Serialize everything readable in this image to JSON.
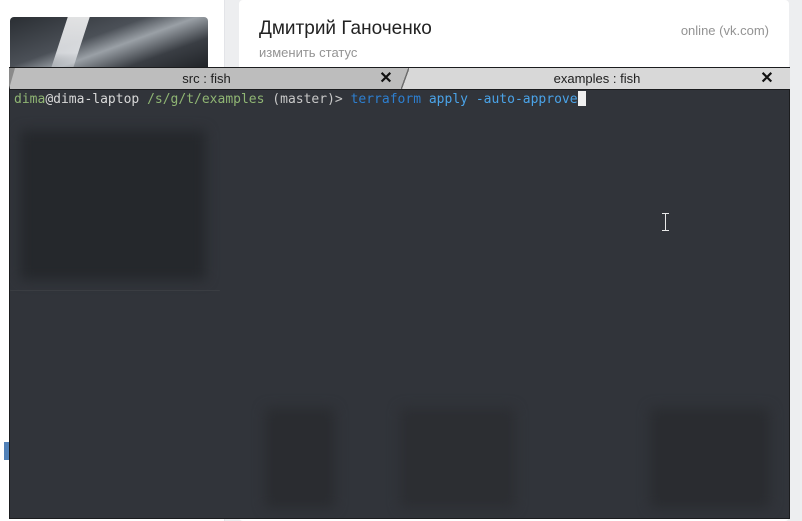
{
  "vk": {
    "profile_name": "Дмитрий Ганоченко",
    "status_link": "изменить статус",
    "online": "online",
    "online_source": "(vk.com)"
  },
  "terminal": {
    "tabs": [
      {
        "label": "src : fish",
        "close": "✕",
        "active": false
      },
      {
        "label": "examples : fish",
        "close": "✕",
        "active": true
      }
    ],
    "prompt": {
      "user": "dima",
      "at": "@",
      "host": "dima-laptop",
      "path": "/s/g/t/examples",
      "branch": "(master)>",
      "command": "terraform",
      "args": "apply -auto-approve"
    }
  },
  "colors": {
    "terminal_bg": "#31343a",
    "prompt_green": "#8fb573",
    "command_blue": "#2d7fd0",
    "vk_blue": "#5181b8"
  },
  "icons": {
    "tab_close": "close-icon",
    "mouse_cursor": "ibeam-cursor-icon"
  }
}
